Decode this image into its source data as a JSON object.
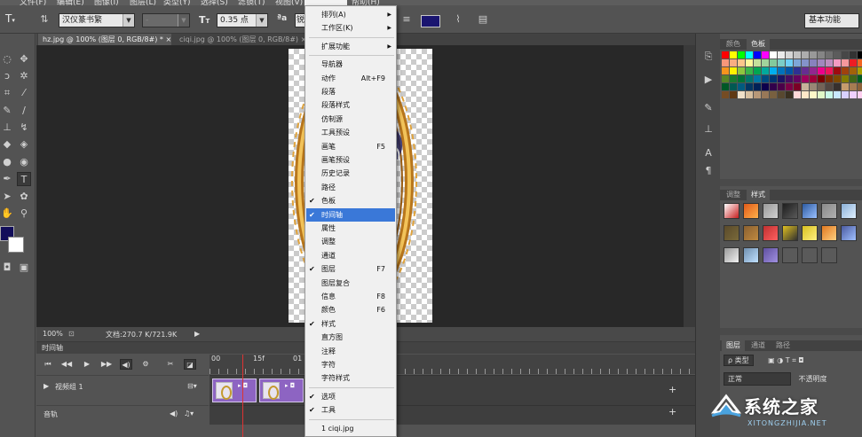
{
  "menubar": {
    "items": [
      "文件(F)",
      "编辑(E)",
      "图像(I)",
      "图层(L)",
      "类型(Y)",
      "选择(S)",
      "滤镜(T)",
      "视图(V)",
      "窗口(W)",
      "帮助(H)"
    ]
  },
  "options_bar": {
    "tool_icon": "type-tool-icon",
    "font_family": "汉仪篆书繁",
    "font_style": "-",
    "font_size": "0.35 点",
    "aa_label": "a",
    "aa_mode": "锐",
    "text_color": "#1a1570",
    "workspace": "基本功能"
  },
  "tabs": [
    {
      "label": "hz.jpg @ 100% (图层 0, RGB/8#) * ×"
    },
    {
      "label": "ciqi.jpg @ 100% (图层 0, RGB/8#) ×"
    }
  ],
  "status": {
    "zoom": "100%",
    "doc_info": "文档:270.7 K/721.9K"
  },
  "timeline": {
    "title": "时间轴",
    "ruler_marks": [
      "00",
      "15f",
      "01"
    ],
    "tracks": [
      {
        "label": "视频组 1"
      },
      {
        "label": "音轨"
      }
    ]
  },
  "window_menu": {
    "title": "窗口(W)",
    "items": [
      {
        "label": "排列(A)",
        "submenu": true
      },
      {
        "label": "工作区(K)",
        "submenu": true
      },
      {
        "sep": true
      },
      {
        "label": "扩展功能",
        "submenu": true
      },
      {
        "sep": true
      },
      {
        "label": "导航器"
      },
      {
        "label": "动作",
        "shortcut": "Alt+F9"
      },
      {
        "label": "段落"
      },
      {
        "label": "段落样式"
      },
      {
        "label": "仿制源"
      },
      {
        "label": "工具预设"
      },
      {
        "label": "画笔",
        "shortcut": "F5"
      },
      {
        "label": "画笔预设"
      },
      {
        "label": "历史记录"
      },
      {
        "label": "路径"
      },
      {
        "label": "色板",
        "checked": true
      },
      {
        "label": "时间轴",
        "checked": true,
        "highlighted": true
      },
      {
        "label": "属性"
      },
      {
        "label": "调整"
      },
      {
        "label": "通道"
      },
      {
        "label": "图层",
        "checked": true,
        "shortcut": "F7"
      },
      {
        "label": "图层复合"
      },
      {
        "label": "信息",
        "shortcut": "F8"
      },
      {
        "label": "颜色",
        "shortcut": "F6"
      },
      {
        "label": "样式",
        "checked": true
      },
      {
        "label": "直方图"
      },
      {
        "label": "注释"
      },
      {
        "label": "字符"
      },
      {
        "label": "字符样式"
      },
      {
        "sep": true
      },
      {
        "label": "选项",
        "checked": true
      },
      {
        "label": "工具",
        "checked": true
      },
      {
        "sep": true
      },
      {
        "label": "1 ciqi.jpg"
      }
    ]
  },
  "panels": {
    "swatches": {
      "tabs": [
        "颜色",
        "色板"
      ]
    },
    "styles": {
      "tabs": [
        "调整",
        "样式"
      ]
    },
    "layers": {
      "tabs": [
        "图层",
        "通道",
        "路径"
      ],
      "filter": "ρ 类型",
      "blend_mode": "正常",
      "opacity_label": "不透明度"
    }
  },
  "watermark": {
    "text": "系统之家",
    "url": "XITONGZHIJIA.NET"
  }
}
